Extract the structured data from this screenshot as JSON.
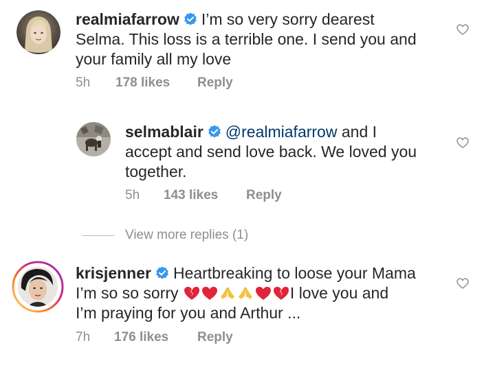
{
  "comments": [
    {
      "username": "realmiafarrow",
      "lines": [
        "I’m so very sorry dearest",
        "Selma. This loss is a terrible one. I send you and",
        "your family all my love"
      ],
      "time": "5h",
      "likes": "178 likes",
      "reply": "Reply"
    },
    {
      "username": "selmablair",
      "mention": "@realmiafarrow",
      "lines": [
        " and I",
        "accept and send love back. We loved you",
        "together."
      ],
      "time": "5h",
      "likes": "143 likes",
      "reply": "Reply"
    },
    {
      "username": "krisjenner",
      "lines": [
        "Heartbreaking to loose your Mama",
        "I’m so so sorry ",
        "I love you and",
        "I’m praying for you and Arthur ..."
      ],
      "time": "7h",
      "likes": "176 likes",
      "reply": "Reply"
    }
  ],
  "view_more": "View more replies (1)",
  "icons": {
    "verified": "verified-badge-icon",
    "heart": "heart-outline-icon",
    "broken_heart": "broken-heart-emoji",
    "red_heart": "red-heart-emoji",
    "folded_hands": "folded-hands-emoji"
  },
  "colors": {
    "text": "#262626",
    "meta": "#8e8e8e",
    "verified": "#3897f0",
    "mention": "#00376b",
    "story_ring": "#d6249f"
  }
}
